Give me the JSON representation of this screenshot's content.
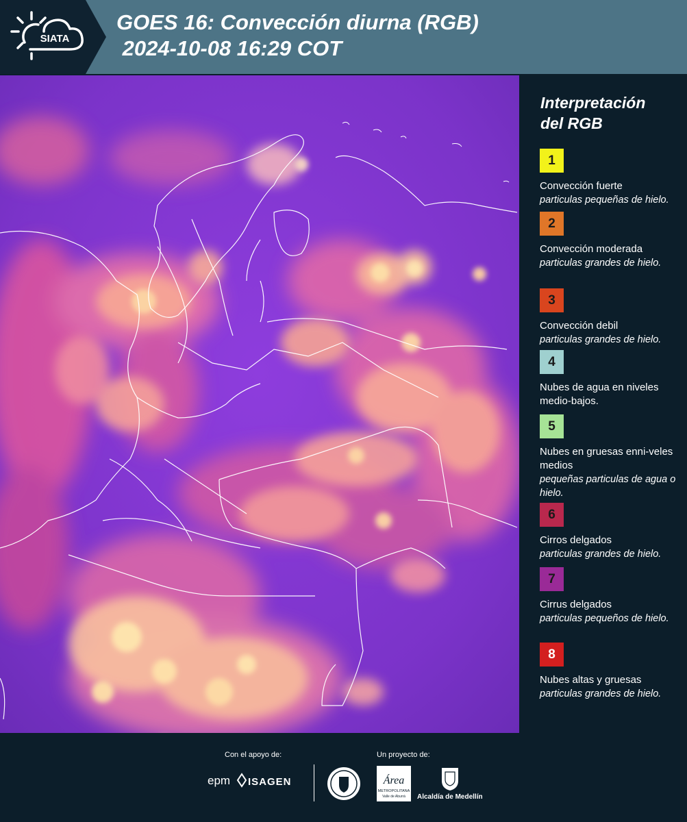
{
  "header": {
    "logo_text": "SIATA",
    "title_line1": "GOES 16: Convección diurna (RGB)",
    "title_line2": " 2024-10-08 16:29 COT"
  },
  "legend": {
    "title_line1": "Interpretación",
    "title_line2": "del RGB",
    "items": [
      {
        "num": "1",
        "color": "#f2f21a",
        "label": "Convección fuerte",
        "sublabel": "particulas pequeñas de hielo."
      },
      {
        "num": "2",
        "color": "#e07628",
        "label": "Convección moderada",
        "sublabel": "particulas grandes de hielo."
      },
      {
        "num": "3",
        "color": "#d9451e",
        "label": "Convección debil",
        "sublabel": "particulas grandes de hielo."
      },
      {
        "num": "4",
        "color": "#9fd0cf",
        "label": "Nubes de agua en niveles medio-bajos.",
        "sublabel": ""
      },
      {
        "num": "5",
        "color": "#a6e396",
        "label": "Nubes en gruesas enni-veles medios",
        "sublabel": "pequeñas particulas de agua o hielo."
      },
      {
        "num": "6",
        "color": "#b9284d",
        "label": "Cirros delgados",
        "sublabel": "particulas grandes de hielo."
      },
      {
        "num": "7",
        "color": "#9a2a97",
        "label": "Cirrus delgados",
        "sublabel": "particulas pequeños de hielo."
      },
      {
        "num": "8",
        "color": "#d31f1f",
        "label": "Nubes altas y gruesas",
        "sublabel": "particulas grandes de hielo."
      }
    ]
  },
  "footer": {
    "support_label": "Con el apoyo de:",
    "project_label": "Un proyecto de:",
    "sponsor1": "epm",
    "sponsor2": "ISAGEN",
    "partner_area": "Área",
    "partner_area_sub": "METROPOLITANA",
    "partner_area_sub2": "Valle de Aburrá",
    "partner_medellin": "Alcaldía de Medellín"
  },
  "colors": {
    "header_bg": "#4d7486",
    "logo_bg": "#0f2230",
    "page_bg": "#0c1e2a",
    "map_base": "#8a37d8",
    "cloud_pink": "#f06aa8",
    "cloud_peach": "#f8b89a",
    "cloud_yellow": "#fde2a0"
  }
}
